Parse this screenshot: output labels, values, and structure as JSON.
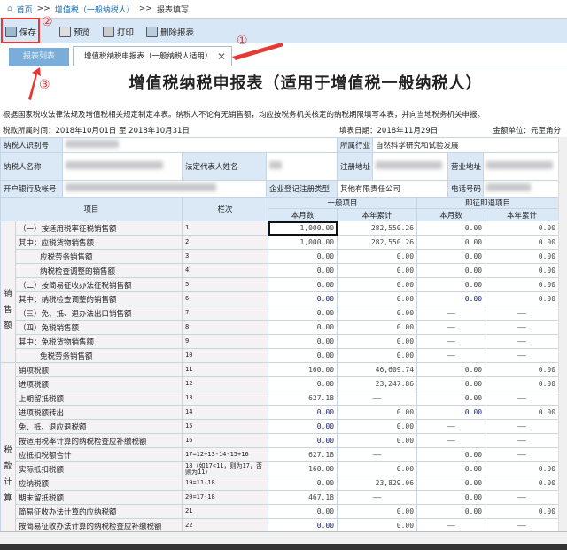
{
  "breadcrumb": {
    "home": "首页",
    "sep": ">>",
    "level1": "增值税（一般纳税人）",
    "current": "报表填写"
  },
  "toolbar": {
    "save": "保存",
    "preview": "预览",
    "print": "打印",
    "delete": "删除报表"
  },
  "tabs": {
    "list": "报表列表",
    "active": "增值税纳税申报表（一般纳税人适用）"
  },
  "title": "增值税纳税申报表（适用于增值税一般纳税人）",
  "notice": "根据国家税收法律法规及增值税相关规定制定本表。纳税人不论有无销售额，均应按税务机关核定的纳税期限填写本表，并向当地税务机关申报。",
  "period": {
    "tax_period": "税款所属时间：2018年10月01日 至 2018年10月31日",
    "fill_date": "填表日期：2018年11月29日",
    "unit": "金额单位：元至角分"
  },
  "info": {
    "taxpayer_id_label": "纳税人识别号",
    "industry_label": "所属行业",
    "industry": "自然科学研究和试验发展",
    "name_label": "纳税人名称",
    "legal_rep_label": "法定代表人姓名",
    "reg_addr_label": "注册地址",
    "biz_addr_label": "营业地址",
    "bank_label": "开户银行及帐号",
    "reg_type_label": "企业登记注册类型",
    "reg_type": "其他有限责任公司",
    "phone_label": "电话号码"
  },
  "header": {
    "item": "项目",
    "line": "栏次",
    "general": "一般项目",
    "refund": "即征即退项目",
    "month": "本月数",
    "year": "本年累计"
  },
  "groups": {
    "sales": "销售额",
    "tax": "税款计算"
  },
  "rows": [
    {
      "item": "（一）按适用税率征税销售额",
      "indent": 0,
      "line": "1",
      "v": [
        "1,000.00",
        "282,550.26",
        "0.00",
        "0.00"
      ],
      "blue": []
    },
    {
      "item": "其中：应税货物销售额",
      "indent": 0,
      "line": "2",
      "v": [
        "1,000.00",
        "282,550.26",
        "0.00",
        "0.00"
      ],
      "blue": []
    },
    {
      "item": "应税劳务销售额",
      "indent": 1,
      "line": "3",
      "v": [
        "0.00",
        "0.00",
        "0.00",
        "0.00"
      ],
      "blue": []
    },
    {
      "item": "纳税检查调整的销售额",
      "indent": 1,
      "line": "4",
      "v": [
        "0.00",
        "0.00",
        "0.00",
        "0.00"
      ],
      "blue": []
    },
    {
      "item": "（二）按简易征收办法征税销售额",
      "indent": 0,
      "line": "5",
      "v": [
        "0.00",
        "0.00",
        "0.00",
        "0.00"
      ],
      "blue": []
    },
    {
      "item": "其中：纳税检查调整的销售额",
      "indent": 0,
      "line": "6",
      "v": [
        "0.00",
        "0.00",
        "0.00",
        "0.00"
      ],
      "blue": [
        0,
        2
      ]
    },
    {
      "item": "（三）免、抵、退办法出口销售额",
      "indent": 0,
      "line": "7",
      "v": [
        "0.00",
        "0.00",
        "——",
        "——"
      ],
      "blue": []
    },
    {
      "item": "（四）免税销售额",
      "indent": 0,
      "line": "8",
      "v": [
        "0.00",
        "0.00",
        "——",
        "——"
      ],
      "blue": []
    },
    {
      "item": "其中：免税货物销售额",
      "indent": 0,
      "line": "9",
      "v": [
        "0.00",
        "0.00",
        "——",
        "——"
      ],
      "blue": []
    },
    {
      "item": "免税劳务销售额",
      "indent": 1,
      "line": "10",
      "v": [
        "0.00",
        "0.00",
        "——",
        "——"
      ],
      "blue": []
    },
    {
      "item": "销项税额",
      "indent": 0,
      "line": "11",
      "v": [
        "160.00",
        "46,609.74",
        "0.00",
        "0.00"
      ],
      "blue": []
    },
    {
      "item": "进项税额",
      "indent": 0,
      "line": "12",
      "v": [
        "0.00",
        "23,247.86",
        "0.00",
        "0.00"
      ],
      "blue": []
    },
    {
      "item": "上期留抵税额",
      "indent": 0,
      "line": "13",
      "v": [
        "627.18",
        "——",
        "0.00",
        "——"
      ],
      "blue": []
    },
    {
      "item": "进项税额转出",
      "indent": 0,
      "line": "14",
      "v": [
        "0.00",
        "0.00",
        "0.00",
        "0.00"
      ],
      "blue": [
        0,
        2
      ]
    },
    {
      "item": "免、抵、退应退税额",
      "indent": 0,
      "line": "15",
      "v": [
        "0.00",
        "0.00",
        "——",
        "——"
      ],
      "blue": [
        0
      ]
    },
    {
      "item": "按适用税率计算的纳税检查应补缴税额",
      "indent": 0,
      "line": "16",
      "v": [
        "0.00",
        "0.00",
        "——",
        "——"
      ],
      "blue": [
        0
      ]
    },
    {
      "item": "应抵扣税额合计",
      "indent": 0,
      "line": "17=12+13-14-15+16",
      "v": [
        "627.18",
        "——",
        "0.00",
        "——"
      ],
      "blue": []
    },
    {
      "item": "实际抵扣税额",
      "indent": 0,
      "line": "18（如17<11，则为17，否则为11）",
      "v": [
        "160.00",
        "0.00",
        "0.00",
        "0.00"
      ],
      "blue": []
    },
    {
      "item": "应纳税额",
      "indent": 0,
      "line": "19=11-18",
      "v": [
        "0.00",
        "23,829.06",
        "0.00",
        "0.00"
      ],
      "blue": []
    },
    {
      "item": "期末留抵税额",
      "indent": 0,
      "line": "20=17-18",
      "v": [
        "467.18",
        "——",
        "0.00",
        "——"
      ],
      "blue": []
    },
    {
      "item": "简易征收办法计算的应纳税额",
      "indent": 0,
      "line": "21",
      "v": [
        "0.00",
        "0.00",
        "0.00",
        "0.00"
      ],
      "blue": []
    },
    {
      "item": "按简易征收办法计算的纳税检查应补缴税额",
      "indent": 0,
      "line": "22",
      "v": [
        "0.00",
        "0.00",
        "——",
        "——"
      ],
      "blue": [
        0
      ]
    }
  ],
  "annotations": {
    "n1": "①",
    "n2": "②",
    "n3": "③",
    "color": "#e53935"
  }
}
